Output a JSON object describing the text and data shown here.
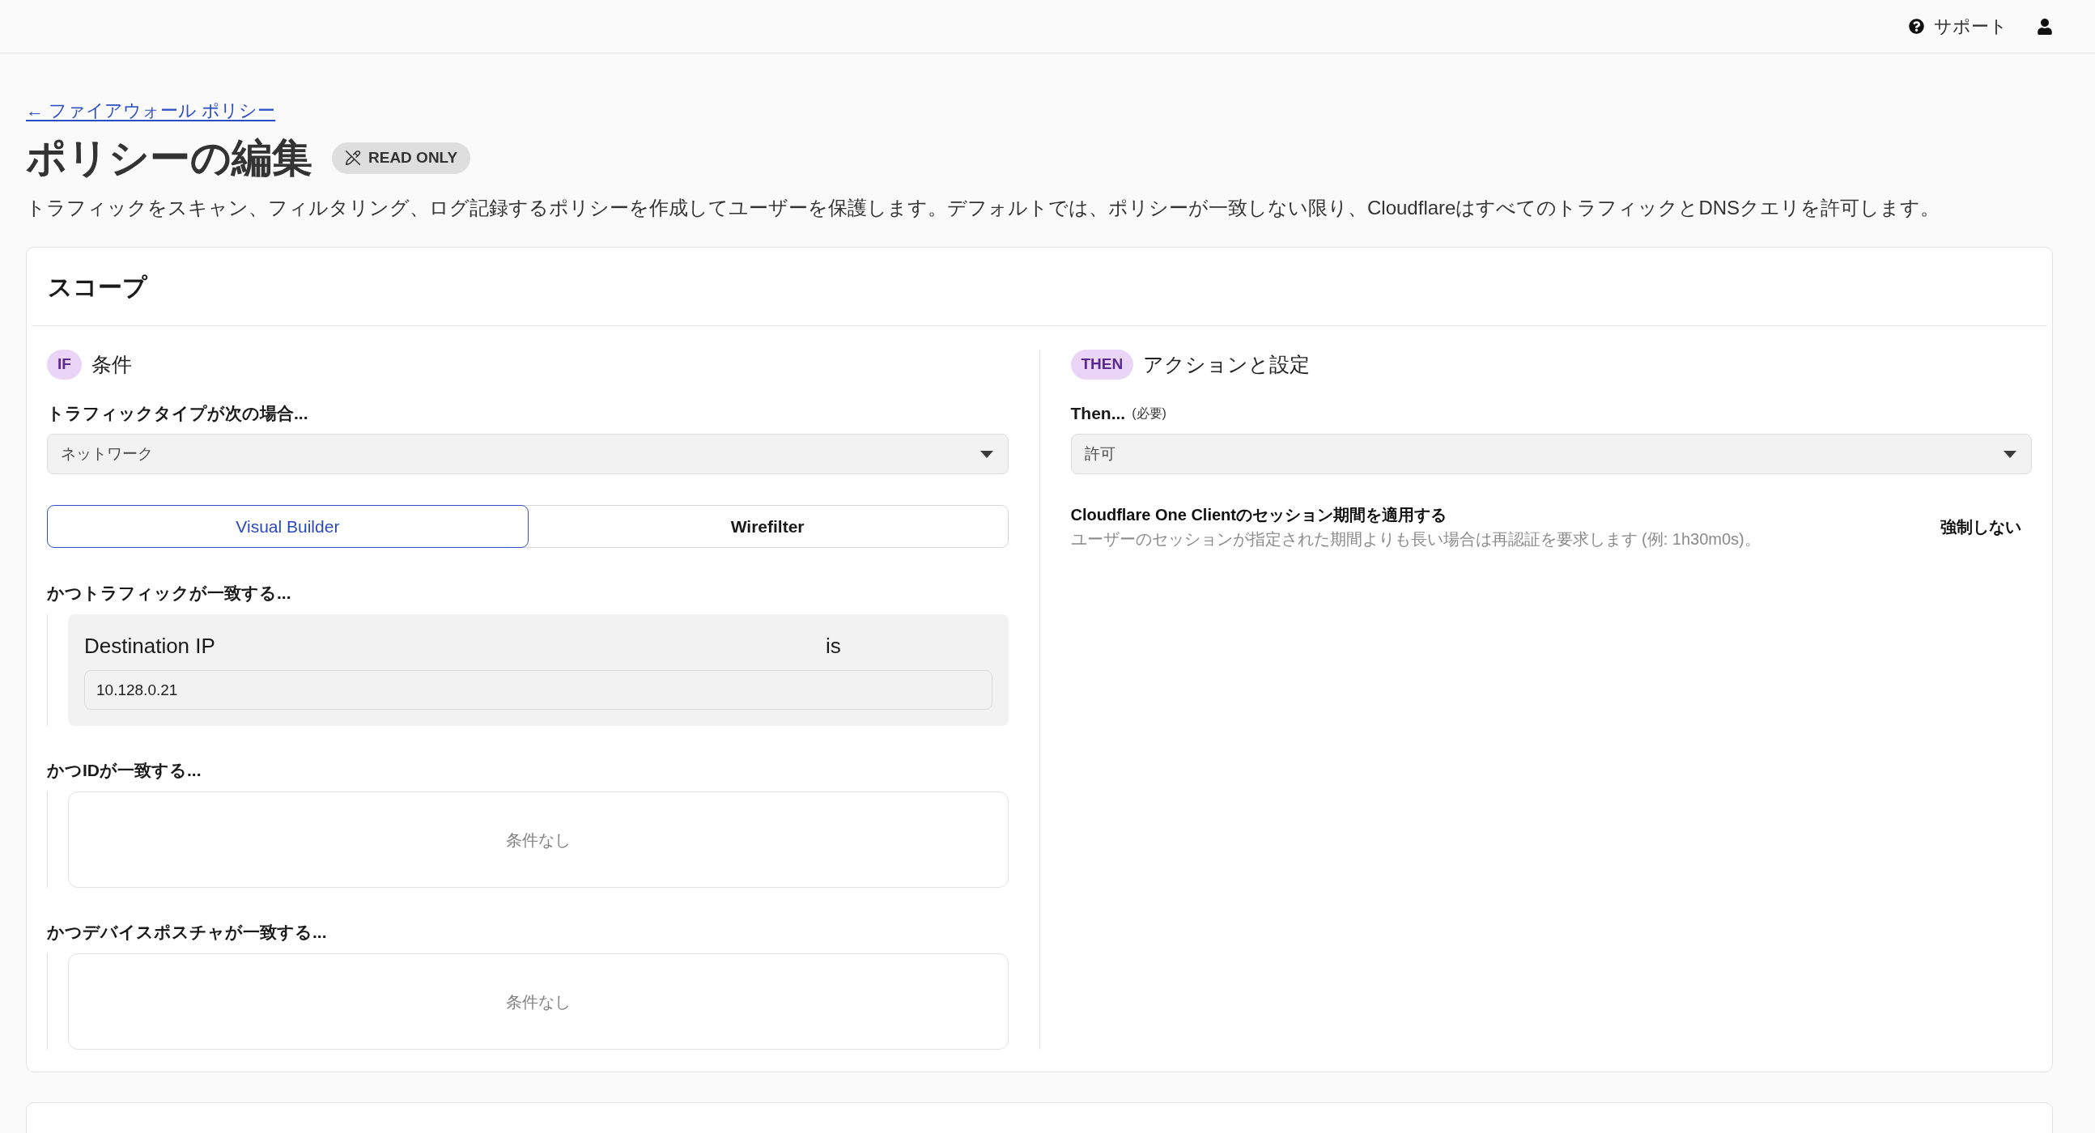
{
  "top_bar": {
    "support_link": "サポート"
  },
  "breadcrumb": {
    "link": "← ファイアウォール ポリシー"
  },
  "page": {
    "title": "ポリシーの編集",
    "badge": "READ ONLY",
    "description": "トラフィックをスキャン、フィルタリング、ログ記録するポリシーを作成してユーザーを保護します。デフォルトでは、ポリシーが一致しない限り、CloudflareはすべてのトラフィックとDNSクエリを許可します。"
  },
  "scope_card": {
    "title": "スコープ",
    "if_section": {
      "tag": "IF",
      "heading": "条件",
      "traffic_type_label": "トラフィックタイプが次の場合...",
      "traffic_type_select": {
        "value": "ネットワーク"
      },
      "builder_tabs": [
        {
          "label": "Visual Builder",
          "selected": true
        },
        {
          "label": "Wirefilter",
          "selected": false
        }
      ],
      "groups": [
        {
          "kind": "conditions",
          "label": "かつトラフィックが一致する...",
          "conditions": [
            {
              "selector": "Destination IP",
              "operator": "is",
              "value": "10.128.0.21"
            }
          ]
        },
        {
          "kind": "empty",
          "label": "かつIDが一致する...",
          "empty_text": "条件なし"
        },
        {
          "kind": "empty",
          "label": "かつデバイスポスチャが一致する...",
          "empty_text": "条件なし"
        }
      ]
    },
    "then_section": {
      "tag": "THEN",
      "heading": "アクションと設定",
      "action_label": "Then...",
      "required_note": "(必要)",
      "action_select": {
        "value": "許可"
      },
      "settings": [
        {
          "title": "Cloudflare One Clientのセッション期間を適用する",
          "description": "ユーザーのセッションが指定された期間よりも長い場合は再認証を要求します (例: 1h30m0s)。",
          "value": "強制しない"
        }
      ]
    }
  }
}
